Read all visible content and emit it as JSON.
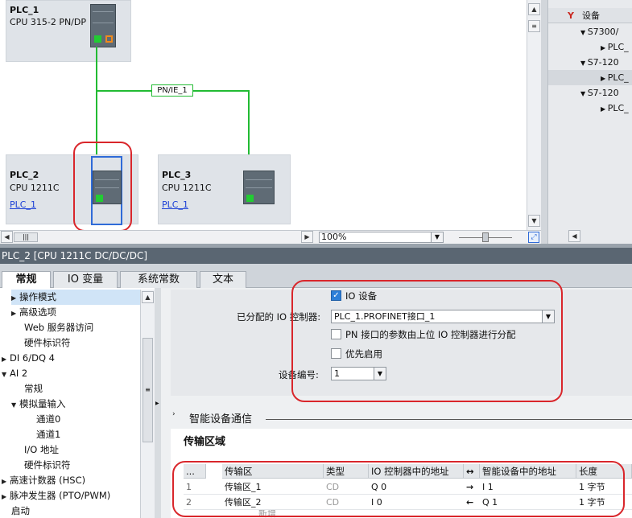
{
  "network": {
    "devices": [
      {
        "name": "PLC_1",
        "type": "CPU 315-2 PN/DP",
        "link": ""
      },
      {
        "name": "PLC_2",
        "type": "CPU 1211C",
        "link": "PLC_1"
      },
      {
        "name": "PLC_3",
        "type": "CPU 1211C",
        "link": "PLC_1"
      }
    ],
    "subnet_label": "PN/IE_1",
    "zoom": "100%"
  },
  "device_tree": {
    "header": "设备",
    "rows": [
      "S7300/",
      "PLC_",
      "S7-120",
      "PLC_",
      "S7-120",
      "PLC_"
    ]
  },
  "properties": {
    "title": "PLC_2 [CPU 1211C DC/DC/DC]",
    "tabs": [
      "常规",
      "IO 变量",
      "系统常数",
      "文本"
    ]
  },
  "nav_tree": {
    "items": [
      {
        "label": "操作模式",
        "arrow": "▶"
      },
      {
        "label": "高级选项",
        "arrow": "▶"
      },
      {
        "label": "Web 服务器访问",
        "arrow": ""
      },
      {
        "label": "硬件标识符",
        "arrow": ""
      },
      {
        "label": "DI 6/DQ 4",
        "arrow": "▶"
      },
      {
        "label": "AI 2",
        "arrow": "▼"
      },
      {
        "label": "常规",
        "arrow": ""
      },
      {
        "label": "模拟量输入",
        "arrow": "▼"
      },
      {
        "label": "通道0",
        "arrow": ""
      },
      {
        "label": "通道1",
        "arrow": ""
      },
      {
        "label": "I/O 地址",
        "arrow": ""
      },
      {
        "label": "硬件标识符",
        "arrow": ""
      },
      {
        "label": "高速计数器 (HSC)",
        "arrow": "▶"
      },
      {
        "label": "脉冲发生器 (PTO/PWM)",
        "arrow": "▶"
      },
      {
        "label": "启动",
        "arrow": ""
      }
    ]
  },
  "settings": {
    "io_device_label": "IO 设备",
    "controller_label": "已分配的 IO 控制器:",
    "controller_value": "PLC_1.PROFINET接口_1",
    "param_label": "PN 接口的参数由上位 IO 控制器进行分配",
    "priority_label": "优先启用",
    "device_no_label": "设备编号:",
    "device_no_value": "1",
    "section_smart": "智能设备通信",
    "section_transfer": "传输区域"
  },
  "transfer_table": {
    "headers": [
      "...",
      "传输区",
      "类型",
      "IO 控制器中的地址",
      "↔",
      "智能设备中的地址",
      "长度"
    ],
    "rows": [
      {
        "num": "1",
        "name": "传输区_1",
        "type": "CD",
        "ctrl_addr": "Q 0",
        "dir": "→",
        "dev_addr": "I 1",
        "len": "1 字节"
      },
      {
        "num": "2",
        "name": "传输区_2",
        "type": "CD",
        "ctrl_addr": "I 0",
        "dir": "←",
        "dev_addr": "Q 1",
        "len": "1 字节"
      }
    ],
    "add_new": "新增"
  }
}
